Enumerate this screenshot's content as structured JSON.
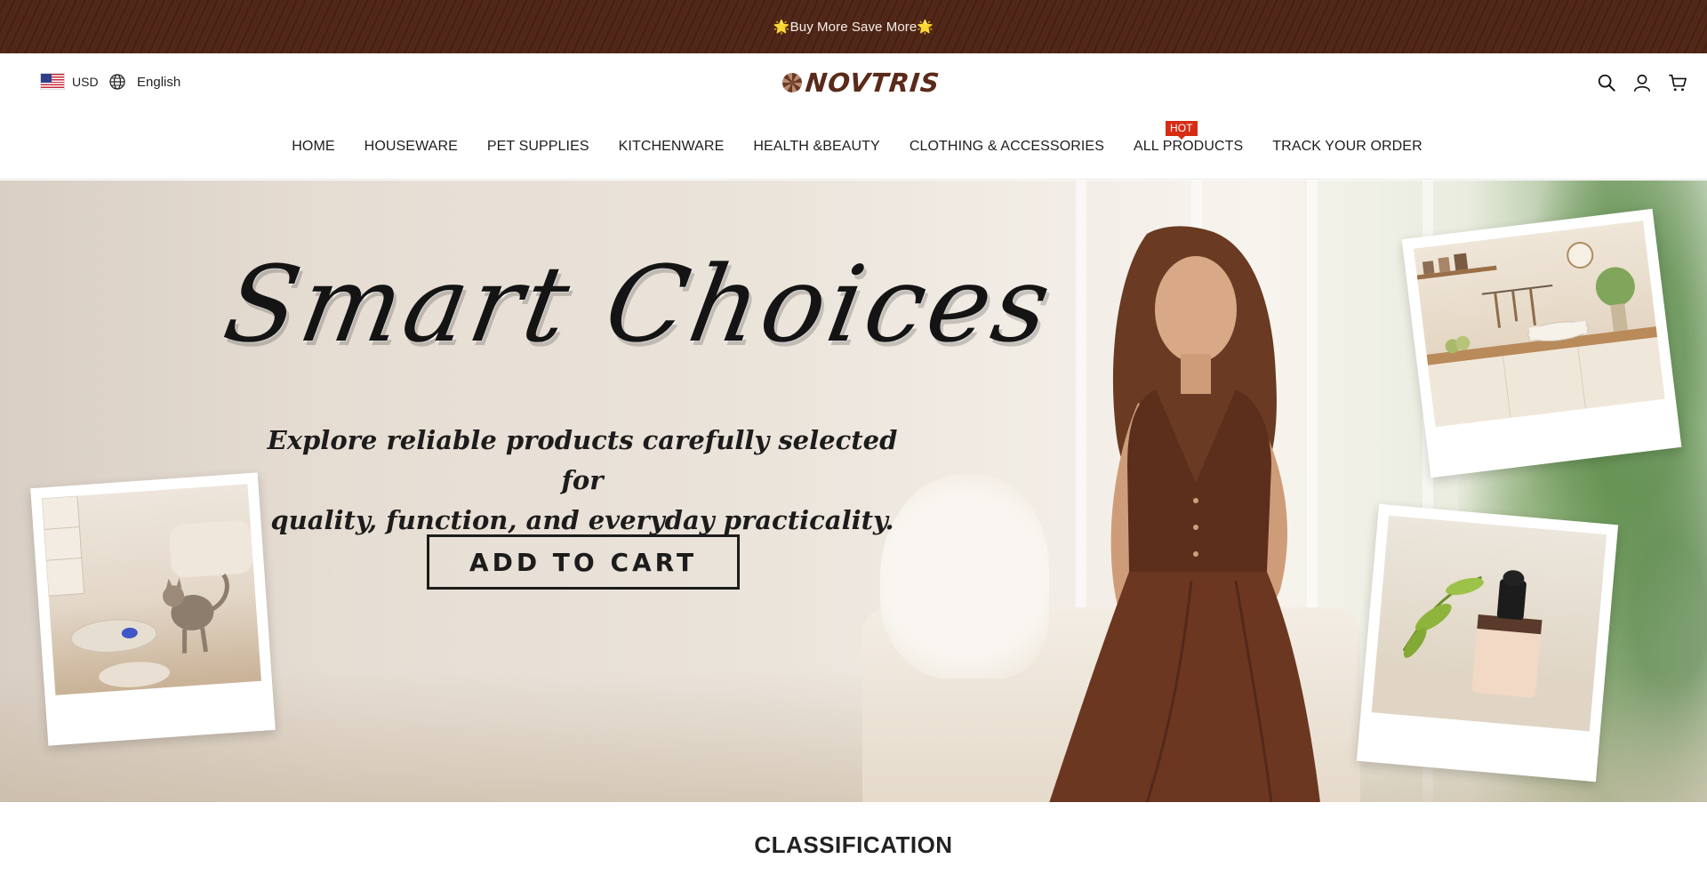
{
  "announcement": {
    "star": "🌟",
    "text": "Buy More Save More"
  },
  "header": {
    "currency": "USD",
    "language": "English",
    "logo_text": "NOVTRIS",
    "icons": [
      "search-icon",
      "account-icon",
      "cart-icon"
    ]
  },
  "nav": {
    "items": [
      {
        "label": "HOME"
      },
      {
        "label": "HOUSEWARE"
      },
      {
        "label": "PET SUPPLIES"
      },
      {
        "label": "KITCHENWARE"
      },
      {
        "label": "HEALTH &BEAUTY"
      },
      {
        "label": "CLOTHING & ACCESSORIES"
      },
      {
        "label": "ALL PRODUCTS",
        "badge": "HOT"
      },
      {
        "label": "TRACK YOUR ORDER"
      }
    ]
  },
  "hero": {
    "headline": "Smart Choices",
    "subhead_line1": "Explore reliable products carefully selected for",
    "subhead_line2": "quality, function, and everyday practicality.",
    "cta_label": "ADD TO CART"
  },
  "section": {
    "title": "CLASSIFICATION"
  },
  "colors": {
    "announcement_bg": "#4a2418",
    "logo": "#5a2a1a",
    "hot_badge": "#d62d14"
  }
}
